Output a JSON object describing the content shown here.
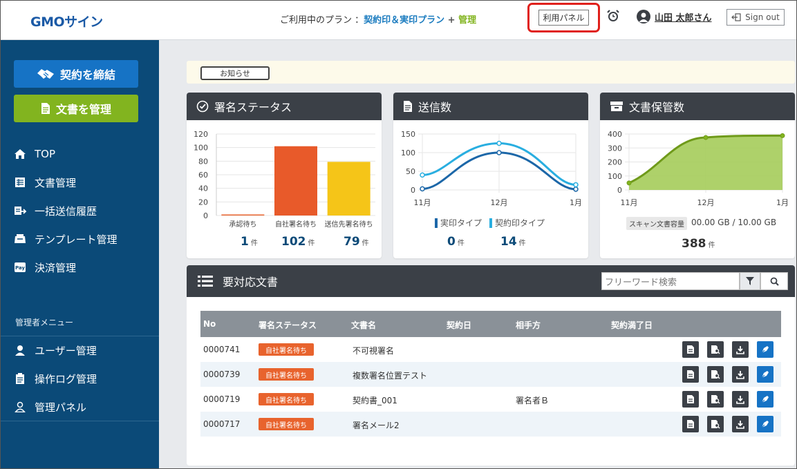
{
  "header": {
    "logo": "GMOサイン",
    "plan_prefix": "ご利用中のプラン ：",
    "plan_name": "契約印＆実印プラン",
    "plan_plus": " + ",
    "plan_admin": "管理",
    "panel_button": "利用パネル",
    "user_name": "山田 太郎さん",
    "signout": "Sign out"
  },
  "sidebar": {
    "contract_button": "契約を締結",
    "manage_button": "文書を管理",
    "nav": [
      {
        "label": "TOP",
        "icon": "home-icon"
      },
      {
        "label": "文書管理",
        "icon": "document-list-icon"
      },
      {
        "label": "一括送信履歴",
        "icon": "bulk-send-icon"
      },
      {
        "label": "テンプレート管理",
        "icon": "template-icon"
      },
      {
        "label": "決済管理",
        "icon": "pay-icon"
      }
    ],
    "admin_heading": "管理者メニュー",
    "admin_nav": [
      {
        "label": "ユーザー管理",
        "icon": "user-icon"
      },
      {
        "label": "操作ログ管理",
        "icon": "log-icon"
      },
      {
        "label": "管理パネル",
        "icon": "admin-user-icon"
      }
    ]
  },
  "notice": {
    "button": "お知らせ"
  },
  "cards": {
    "sign_status": {
      "title": "署名ステータス",
      "stats": [
        {
          "value": "1",
          "unit": "件"
        },
        {
          "value": "102",
          "unit": "件"
        },
        {
          "value": "79",
          "unit": "件"
        }
      ]
    },
    "sent": {
      "title": "送信数",
      "legend": [
        "実印タイプ",
        "契約印タイプ"
      ],
      "stats": [
        {
          "value": "0",
          "unit": "件"
        },
        {
          "value": "14",
          "unit": "件"
        }
      ]
    },
    "storage": {
      "title": "文書保管数",
      "label": "スキャン文書容量",
      "value": "00.00 GB / 10.00 GB",
      "count": "388",
      "unit": "件"
    }
  },
  "chart_data": [
    {
      "type": "bar",
      "categories": [
        "承認待ち",
        "自社署名待ち",
        "送信先署名待ち"
      ],
      "values": [
        1,
        102,
        79
      ],
      "colors": [
        "#e8632d",
        "#e85a2a",
        "#f5c518"
      ],
      "ylim": [
        0,
        120
      ],
      "yticks": [
        0,
        20,
        40,
        60,
        80,
        100,
        120
      ],
      "grid": true
    },
    {
      "type": "line",
      "x": [
        "11月",
        "12月",
        "1月"
      ],
      "series": [
        {
          "name": "実印タイプ",
          "values": [
            3,
            100,
            2
          ],
          "color": "#1c67a8"
        },
        {
          "name": "契約印タイプ",
          "values": [
            40,
            125,
            14
          ],
          "color": "#29aee0"
        }
      ],
      "ylim": [
        0,
        150
      ],
      "yticks": [
        0,
        50,
        100,
        150
      ],
      "grid": true
    },
    {
      "type": "area",
      "x": [
        "11月",
        "12月",
        "1月"
      ],
      "values": [
        50,
        375,
        388
      ],
      "color": "#82b41f",
      "ylim": [
        0,
        400
      ],
      "yticks": [
        0,
        100,
        200,
        300,
        400
      ],
      "grid": true
    }
  ],
  "todo": {
    "title": "要対応文書",
    "search_placeholder": "フリーワード検索",
    "columns": [
      "No",
      "署名ステータス",
      "文書名",
      "契約日",
      "相手方",
      "契約満了日"
    ],
    "rows": [
      {
        "no": "0000741",
        "status": "自社署名待ち",
        "name": "不可視署名",
        "date": "",
        "party": "",
        "expiry": ""
      },
      {
        "no": "0000739",
        "status": "自社署名待ち",
        "name": "複数署名位置テスト",
        "date": "",
        "party": "",
        "expiry": ""
      },
      {
        "no": "0000719",
        "status": "自社署名待ち",
        "name": "契約書_001",
        "date": "",
        "party": "署名者Ｂ",
        "expiry": ""
      },
      {
        "no": "0000717",
        "status": "自社署名待ち",
        "name": "署名メール2",
        "date": "",
        "party": "",
        "expiry": ""
      }
    ]
  }
}
